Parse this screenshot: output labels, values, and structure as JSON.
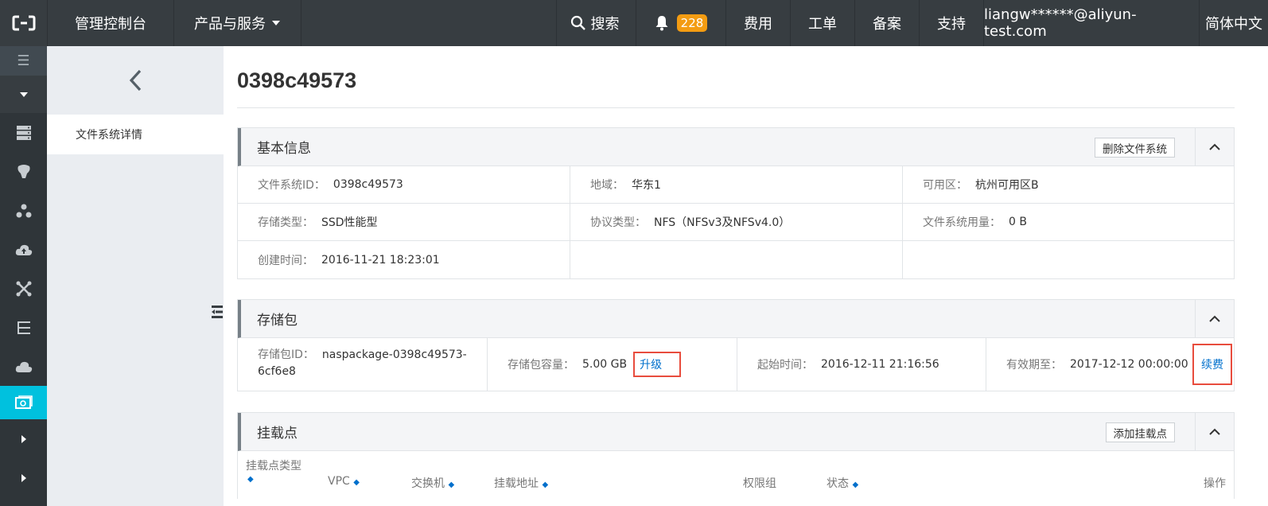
{
  "topbar": {
    "console": "管理控制台",
    "products": "产品与服务",
    "search": "搜索",
    "notifications": "228",
    "fee": "费用",
    "ticket": "工单",
    "record": "备案",
    "support": "支持",
    "user": "liangw******@aliyun-test.com",
    "language": "简体中文"
  },
  "subnav": {
    "item": "文件系统详情"
  },
  "page": {
    "title": "0398c49573"
  },
  "basic": {
    "title": "基本信息",
    "delete_button": "删除文件系统",
    "fields": [
      {
        "label": "文件系统ID：",
        "value": "0398c49573"
      },
      {
        "label": "地域：",
        "value": "华东1"
      },
      {
        "label": "可用区：",
        "value": "杭州可用区B"
      },
      {
        "label": "存储类型：",
        "value": "SSD性能型"
      },
      {
        "label": "协议类型：",
        "value": "NFS（NFSv3及NFSv4.0）"
      },
      {
        "label": "文件系统用量：",
        "value": "0 B"
      },
      {
        "label": "创建时间：",
        "value": "2016-11-21 18:23:01"
      }
    ]
  },
  "package": {
    "title": "存储包",
    "id_label": "存储包ID：",
    "id_value_line1": "naspackage-0398c49573-",
    "id_value_line2": "6cf6e8",
    "capacity_label": "存储包容量：",
    "capacity_value": "5.00 GB",
    "upgrade_link": "升级",
    "start_label": "起始时间：",
    "start_value": "2016-12-11 21:16:56",
    "expire_label": "有效期至：",
    "expire_value": "2017-12-12 00:00:00",
    "renew_link": "续费"
  },
  "mount": {
    "title": "挂载点",
    "add_button": "添加挂载点",
    "columns": {
      "type_line1": "挂载点类型",
      "vpc": "VPC",
      "switch": "交换机",
      "address": "挂载地址",
      "access_group": "权限组",
      "status": "状态",
      "actions": "操作"
    }
  }
}
